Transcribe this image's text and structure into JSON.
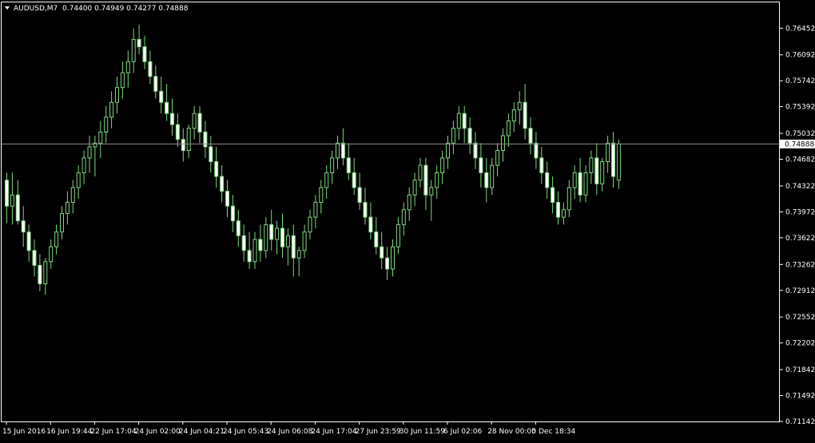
{
  "header": {
    "symbol": "AUDUSD,M7",
    "ohlc": "0.74400 0.74949 0.74277 0.74888"
  },
  "colors": {
    "background": "#000000",
    "frame": "#ffffff",
    "text": "#ffffff",
    "candle_stroke": "#7dd87d",
    "candle_bear_fill": "#ffffff",
    "candle_bull_fill": "#000000",
    "price_line": "#8a8a8a",
    "price_label_bg": "#ffffff",
    "price_label_text": "#000000"
  },
  "chart_data": {
    "type": "candlestick",
    "ylim": [
      0.71142,
      0.768
    ],
    "y_ticks": [
      "0.76452",
      "0.76092",
      "0.75742",
      "0.75392",
      "0.75032",
      "0.74682",
      "0.74322",
      "0.73972",
      "0.73622",
      "0.73262",
      "0.72912",
      "0.72552",
      "0.72202",
      "0.71842",
      "0.71492",
      "0.71142"
    ],
    "x_ticks": [
      {
        "label": "15 Jun 2016",
        "index": 0
      },
      {
        "label": "16 Jun 19:44",
        "index": 8
      },
      {
        "label": "22 Jun 17:04",
        "index": 16
      },
      {
        "label": "24 Jun 02:00",
        "index": 24
      },
      {
        "label": "24 Jun 04:21",
        "index": 32
      },
      {
        "label": "24 Jun 05:43",
        "index": 40
      },
      {
        "label": "24 Jun 06:08",
        "index": 48
      },
      {
        "label": "24 Jun 17:04",
        "index": 56
      },
      {
        "label": "27 Jun 23:59",
        "index": 64
      },
      {
        "label": "30 Jun 11:59",
        "index": 72
      },
      {
        "label": "6 Jul 02:06",
        "index": 80
      },
      {
        "label": "28 Nov 00:00",
        "index": 88
      },
      {
        "label": "5 Dec 18:34",
        "index": 96
      }
    ],
    "current_price": "0.74888",
    "candles": [
      {
        "o": 0.744,
        "h": 0.745,
        "l": 0.7382,
        "c": 0.7405
      },
      {
        "o": 0.7405,
        "h": 0.745,
        "l": 0.738,
        "c": 0.742
      },
      {
        "o": 0.742,
        "h": 0.744,
        "l": 0.738,
        "c": 0.7385
      },
      {
        "o": 0.7385,
        "h": 0.7405,
        "l": 0.735,
        "c": 0.737
      },
      {
        "o": 0.737,
        "h": 0.738,
        "l": 0.733,
        "c": 0.7345
      },
      {
        "o": 0.7345,
        "h": 0.736,
        "l": 0.731,
        "c": 0.7325
      },
      {
        "o": 0.7325,
        "h": 0.734,
        "l": 0.729,
        "c": 0.73
      },
      {
        "o": 0.73,
        "h": 0.7335,
        "l": 0.7285,
        "c": 0.733
      },
      {
        "o": 0.733,
        "h": 0.736,
        "l": 0.732,
        "c": 0.735
      },
      {
        "o": 0.735,
        "h": 0.738,
        "l": 0.734,
        "c": 0.737
      },
      {
        "o": 0.737,
        "h": 0.7405,
        "l": 0.736,
        "c": 0.7395
      },
      {
        "o": 0.7395,
        "h": 0.7425,
        "l": 0.738,
        "c": 0.741
      },
      {
        "o": 0.741,
        "h": 0.744,
        "l": 0.7395,
        "c": 0.743
      },
      {
        "o": 0.743,
        "h": 0.746,
        "l": 0.7415,
        "c": 0.745
      },
      {
        "o": 0.745,
        "h": 0.748,
        "l": 0.7435,
        "c": 0.747
      },
      {
        "o": 0.747,
        "h": 0.75,
        "l": 0.745,
        "c": 0.7485
      },
      {
        "o": 0.7485,
        "h": 0.75,
        "l": 0.7445,
        "c": 0.749
      },
      {
        "o": 0.749,
        "h": 0.752,
        "l": 0.747,
        "c": 0.7505
      },
      {
        "o": 0.7505,
        "h": 0.754,
        "l": 0.749,
        "c": 0.7525
      },
      {
        "o": 0.7525,
        "h": 0.756,
        "l": 0.751,
        "c": 0.7545
      },
      {
        "o": 0.7545,
        "h": 0.758,
        "l": 0.753,
        "c": 0.7565
      },
      {
        "o": 0.7565,
        "h": 0.76,
        "l": 0.755,
        "c": 0.7585
      },
      {
        "o": 0.7585,
        "h": 0.7615,
        "l": 0.7565,
        "c": 0.76
      },
      {
        "o": 0.76,
        "h": 0.7645,
        "l": 0.7585,
        "c": 0.763
      },
      {
        "o": 0.763,
        "h": 0.765,
        "l": 0.761,
        "c": 0.762
      },
      {
        "o": 0.762,
        "h": 0.7635,
        "l": 0.759,
        "c": 0.76
      },
      {
        "o": 0.76,
        "h": 0.7615,
        "l": 0.757,
        "c": 0.758
      },
      {
        "o": 0.758,
        "h": 0.7595,
        "l": 0.755,
        "c": 0.756
      },
      {
        "o": 0.756,
        "h": 0.758,
        "l": 0.753,
        "c": 0.7545
      },
      {
        "o": 0.7545,
        "h": 0.757,
        "l": 0.752,
        "c": 0.753
      },
      {
        "o": 0.753,
        "h": 0.755,
        "l": 0.75,
        "c": 0.7515
      },
      {
        "o": 0.7515,
        "h": 0.753,
        "l": 0.7485,
        "c": 0.7495
      },
      {
        "o": 0.7495,
        "h": 0.751,
        "l": 0.7465,
        "c": 0.748
      },
      {
        "o": 0.748,
        "h": 0.7515,
        "l": 0.747,
        "c": 0.751
      },
      {
        "o": 0.751,
        "h": 0.754,
        "l": 0.7495,
        "c": 0.753
      },
      {
        "o": 0.753,
        "h": 0.754,
        "l": 0.749,
        "c": 0.7505
      },
      {
        "o": 0.7505,
        "h": 0.752,
        "l": 0.747,
        "c": 0.7485
      },
      {
        "o": 0.7485,
        "h": 0.75,
        "l": 0.745,
        "c": 0.7465
      },
      {
        "o": 0.7465,
        "h": 0.7485,
        "l": 0.743,
        "c": 0.7445
      },
      {
        "o": 0.7445,
        "h": 0.746,
        "l": 0.741,
        "c": 0.7425
      },
      {
        "o": 0.7425,
        "h": 0.744,
        "l": 0.739,
        "c": 0.7405
      },
      {
        "o": 0.7405,
        "h": 0.742,
        "l": 0.737,
        "c": 0.7385
      },
      {
        "o": 0.7385,
        "h": 0.74,
        "l": 0.735,
        "c": 0.7365
      },
      {
        "o": 0.7365,
        "h": 0.738,
        "l": 0.733,
        "c": 0.7345
      },
      {
        "o": 0.7345,
        "h": 0.737,
        "l": 0.732,
        "c": 0.733
      },
      {
        "o": 0.733,
        "h": 0.737,
        "l": 0.732,
        "c": 0.736
      },
      {
        "o": 0.736,
        "h": 0.738,
        "l": 0.733,
        "c": 0.7345
      },
      {
        "o": 0.7345,
        "h": 0.739,
        "l": 0.7335,
        "c": 0.738
      },
      {
        "o": 0.738,
        "h": 0.74,
        "l": 0.7345,
        "c": 0.736
      },
      {
        "o": 0.736,
        "h": 0.7385,
        "l": 0.734,
        "c": 0.7375
      },
      {
        "o": 0.7375,
        "h": 0.7395,
        "l": 0.7335,
        "c": 0.735
      },
      {
        "o": 0.735,
        "h": 0.7375,
        "l": 0.7325,
        "c": 0.7365
      },
      {
        "o": 0.7365,
        "h": 0.738,
        "l": 0.731,
        "c": 0.7335
      },
      {
        "o": 0.7335,
        "h": 0.735,
        "l": 0.731,
        "c": 0.7345
      },
      {
        "o": 0.7345,
        "h": 0.738,
        "l": 0.7335,
        "c": 0.737
      },
      {
        "o": 0.737,
        "h": 0.74,
        "l": 0.736,
        "c": 0.739
      },
      {
        "o": 0.739,
        "h": 0.742,
        "l": 0.7375,
        "c": 0.741
      },
      {
        "o": 0.741,
        "h": 0.744,
        "l": 0.7395,
        "c": 0.743
      },
      {
        "o": 0.743,
        "h": 0.746,
        "l": 0.7415,
        "c": 0.745
      },
      {
        "o": 0.745,
        "h": 0.748,
        "l": 0.7435,
        "c": 0.747
      },
      {
        "o": 0.747,
        "h": 0.75,
        "l": 0.7455,
        "c": 0.749
      },
      {
        "o": 0.749,
        "h": 0.751,
        "l": 0.746,
        "c": 0.747
      },
      {
        "o": 0.747,
        "h": 0.749,
        "l": 0.744,
        "c": 0.745
      },
      {
        "o": 0.745,
        "h": 0.747,
        "l": 0.742,
        "c": 0.743
      },
      {
        "o": 0.743,
        "h": 0.745,
        "l": 0.74,
        "c": 0.741
      },
      {
        "o": 0.741,
        "h": 0.743,
        "l": 0.738,
        "c": 0.739
      },
      {
        "o": 0.739,
        "h": 0.741,
        "l": 0.736,
        "c": 0.737
      },
      {
        "o": 0.737,
        "h": 0.739,
        "l": 0.734,
        "c": 0.735
      },
      {
        "o": 0.735,
        "h": 0.737,
        "l": 0.732,
        "c": 0.7335
      },
      {
        "o": 0.7335,
        "h": 0.735,
        "l": 0.7305,
        "c": 0.732
      },
      {
        "o": 0.732,
        "h": 0.736,
        "l": 0.731,
        "c": 0.735
      },
      {
        "o": 0.735,
        "h": 0.739,
        "l": 0.734,
        "c": 0.738
      },
      {
        "o": 0.738,
        "h": 0.741,
        "l": 0.7365,
        "c": 0.74
      },
      {
        "o": 0.74,
        "h": 0.743,
        "l": 0.7385,
        "c": 0.742
      },
      {
        "o": 0.742,
        "h": 0.745,
        "l": 0.7405,
        "c": 0.744
      },
      {
        "o": 0.744,
        "h": 0.747,
        "l": 0.743,
        "c": 0.746
      },
      {
        "o": 0.746,
        "h": 0.747,
        "l": 0.74,
        "c": 0.742
      },
      {
        "o": 0.742,
        "h": 0.744,
        "l": 0.7385,
        "c": 0.743
      },
      {
        "o": 0.743,
        "h": 0.746,
        "l": 0.7415,
        "c": 0.745
      },
      {
        "o": 0.745,
        "h": 0.748,
        "l": 0.7435,
        "c": 0.747
      },
      {
        "o": 0.747,
        "h": 0.75,
        "l": 0.7455,
        "c": 0.749
      },
      {
        "o": 0.749,
        "h": 0.752,
        "l": 0.7475,
        "c": 0.751
      },
      {
        "o": 0.751,
        "h": 0.754,
        "l": 0.7495,
        "c": 0.753
      },
      {
        "o": 0.753,
        "h": 0.754,
        "l": 0.749,
        "c": 0.751
      },
      {
        "o": 0.751,
        "h": 0.7525,
        "l": 0.7475,
        "c": 0.749
      },
      {
        "o": 0.749,
        "h": 0.7505,
        "l": 0.7455,
        "c": 0.747
      },
      {
        "o": 0.747,
        "h": 0.749,
        "l": 0.743,
        "c": 0.745
      },
      {
        "o": 0.745,
        "h": 0.747,
        "l": 0.741,
        "c": 0.743
      },
      {
        "o": 0.743,
        "h": 0.747,
        "l": 0.742,
        "c": 0.746
      },
      {
        "o": 0.746,
        "h": 0.749,
        "l": 0.7445,
        "c": 0.748
      },
      {
        "o": 0.748,
        "h": 0.751,
        "l": 0.7465,
        "c": 0.75
      },
      {
        "o": 0.75,
        "h": 0.753,
        "l": 0.7485,
        "c": 0.752
      },
      {
        "o": 0.752,
        "h": 0.7545,
        "l": 0.7505,
        "c": 0.7535
      },
      {
        "o": 0.7535,
        "h": 0.756,
        "l": 0.7515,
        "c": 0.7545
      },
      {
        "o": 0.7545,
        "h": 0.757,
        "l": 0.7495,
        "c": 0.751
      },
      {
        "o": 0.751,
        "h": 0.7525,
        "l": 0.7475,
        "c": 0.749
      },
      {
        "o": 0.749,
        "h": 0.7505,
        "l": 0.7455,
        "c": 0.747
      },
      {
        "o": 0.747,
        "h": 0.7485,
        "l": 0.7435,
        "c": 0.745
      },
      {
        "o": 0.745,
        "h": 0.7465,
        "l": 0.7415,
        "c": 0.743
      },
      {
        "o": 0.743,
        "h": 0.7445,
        "l": 0.7395,
        "c": 0.741
      },
      {
        "o": 0.741,
        "h": 0.7425,
        "l": 0.738,
        "c": 0.739
      },
      {
        "o": 0.739,
        "h": 0.741,
        "l": 0.738,
        "c": 0.74
      },
      {
        "o": 0.74,
        "h": 0.744,
        "l": 0.739,
        "c": 0.743
      },
      {
        "o": 0.743,
        "h": 0.746,
        "l": 0.7415,
        "c": 0.745
      },
      {
        "o": 0.745,
        "h": 0.747,
        "l": 0.741,
        "c": 0.742
      },
      {
        "o": 0.742,
        "h": 0.746,
        "l": 0.741,
        "c": 0.745
      },
      {
        "o": 0.745,
        "h": 0.748,
        "l": 0.7435,
        "c": 0.747
      },
      {
        "o": 0.747,
        "h": 0.749,
        "l": 0.742,
        "c": 0.7435
      },
      {
        "o": 0.7435,
        "h": 0.747,
        "l": 0.7425,
        "c": 0.7465
      },
      {
        "o": 0.7465,
        "h": 0.75,
        "l": 0.745,
        "c": 0.749
      },
      {
        "o": 0.749,
        "h": 0.7505,
        "l": 0.743,
        "c": 0.7445
      },
      {
        "o": 0.744,
        "h": 0.7495,
        "l": 0.7428,
        "c": 0.7489
      }
    ]
  }
}
